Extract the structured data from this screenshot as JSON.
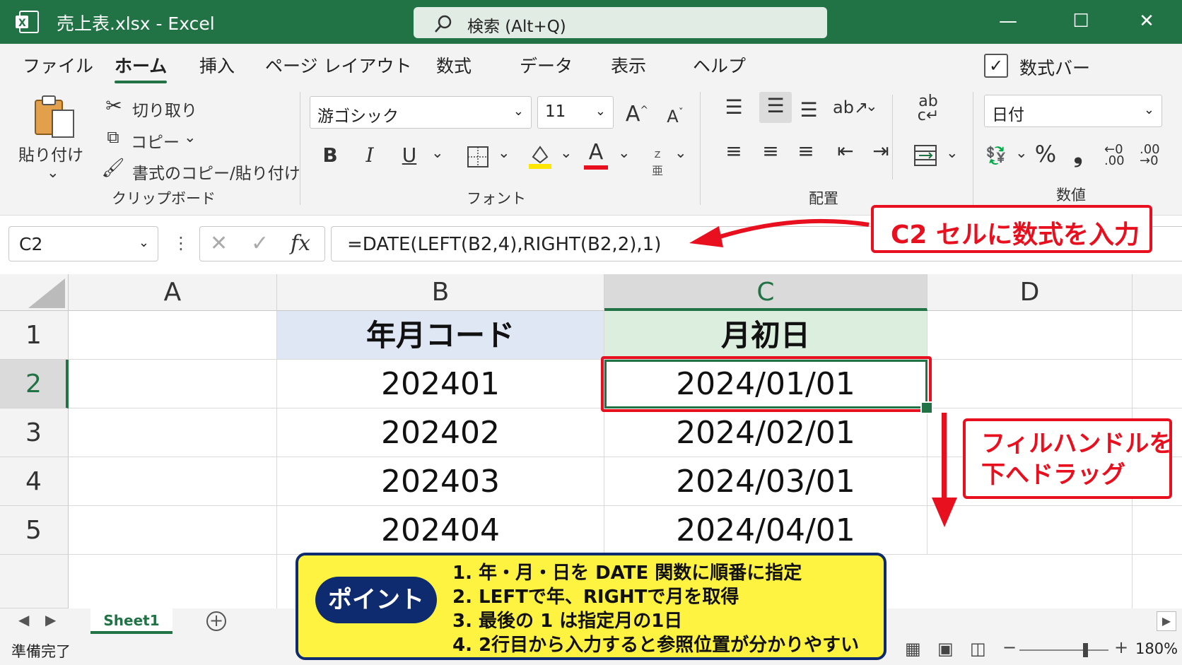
{
  "titlebar": {
    "filename": "売上表.xlsx  -  Excel",
    "search_placeholder": "検索 (Alt+Q)",
    "minimize": "—",
    "maximize": "☐",
    "close": "✕"
  },
  "tabs": [
    "ファイル",
    "ホーム",
    "挿入",
    "ページ レイアウト",
    "数式",
    "データ",
    "表示",
    "ヘルプ"
  ],
  "active_tab": "ホーム",
  "formula_bar_toggle": {
    "label": "数式バー",
    "checked": true
  },
  "ribbon": {
    "clipboard": {
      "paste": "貼り付け",
      "cut": "切り取り",
      "copy": "コピー",
      "format_painter": "書式のコピー/貼り付け",
      "group": "クリップボード"
    },
    "font": {
      "name": "游ゴシック",
      "size": "11",
      "bold": "B",
      "italic": "I",
      "underline": "U",
      "font_color": "A",
      "grow": "A",
      "shrink": "A",
      "group": "フォント"
    },
    "alignment": {
      "group": "配置"
    },
    "number": {
      "format": "日付",
      "percent": "%",
      "comma": "❟",
      "inc": ".00",
      "dec": ".00",
      "group": "数値"
    },
    "colors": {
      "accent": "#217346",
      "highlight_yellow": "#ffe600",
      "font_red": "#e8101e"
    }
  },
  "name_box": "C2",
  "formula": "=DATE(LEFT(B2,4),RIGHT(B2,2),1)",
  "fx_icons": {
    "cancel": "✕",
    "enter": "✓",
    "fx": "fx"
  },
  "grid": {
    "columns": [
      "A",
      "B",
      "C",
      "D"
    ],
    "rows": [
      "1",
      "2",
      "3",
      "4",
      "5"
    ],
    "header_b": "年月コード",
    "header_c": "月初日",
    "b_values": [
      "202401",
      "202402",
      "202403",
      "202404"
    ],
    "c_values": [
      "2024/01/01",
      "2024/02/01",
      "2024/03/01",
      "2024/04/01"
    ],
    "header_b_color": "#dfe7f5",
    "header_c_color": "#dcefdf"
  },
  "sheet_tab": "Sheet1",
  "add_sheet": "+",
  "status": {
    "ready": "準備完了",
    "zoom": "180%"
  },
  "annotations": {
    "formula_callout": "C2 セルに数式を入力",
    "fill_callout_1": "フィルハンドルを",
    "fill_callout_2": "下へドラッグ",
    "point_label": "ポイント",
    "points": [
      "1.  年・月・日を DATE 関数に順番に指定",
      "2.  LEFTで年、RIGHTで月を取得",
      "3.  最後の 1 は指定月の1日",
      "4.  2行目から入力すると参照位置が分かりやすい"
    ]
  }
}
